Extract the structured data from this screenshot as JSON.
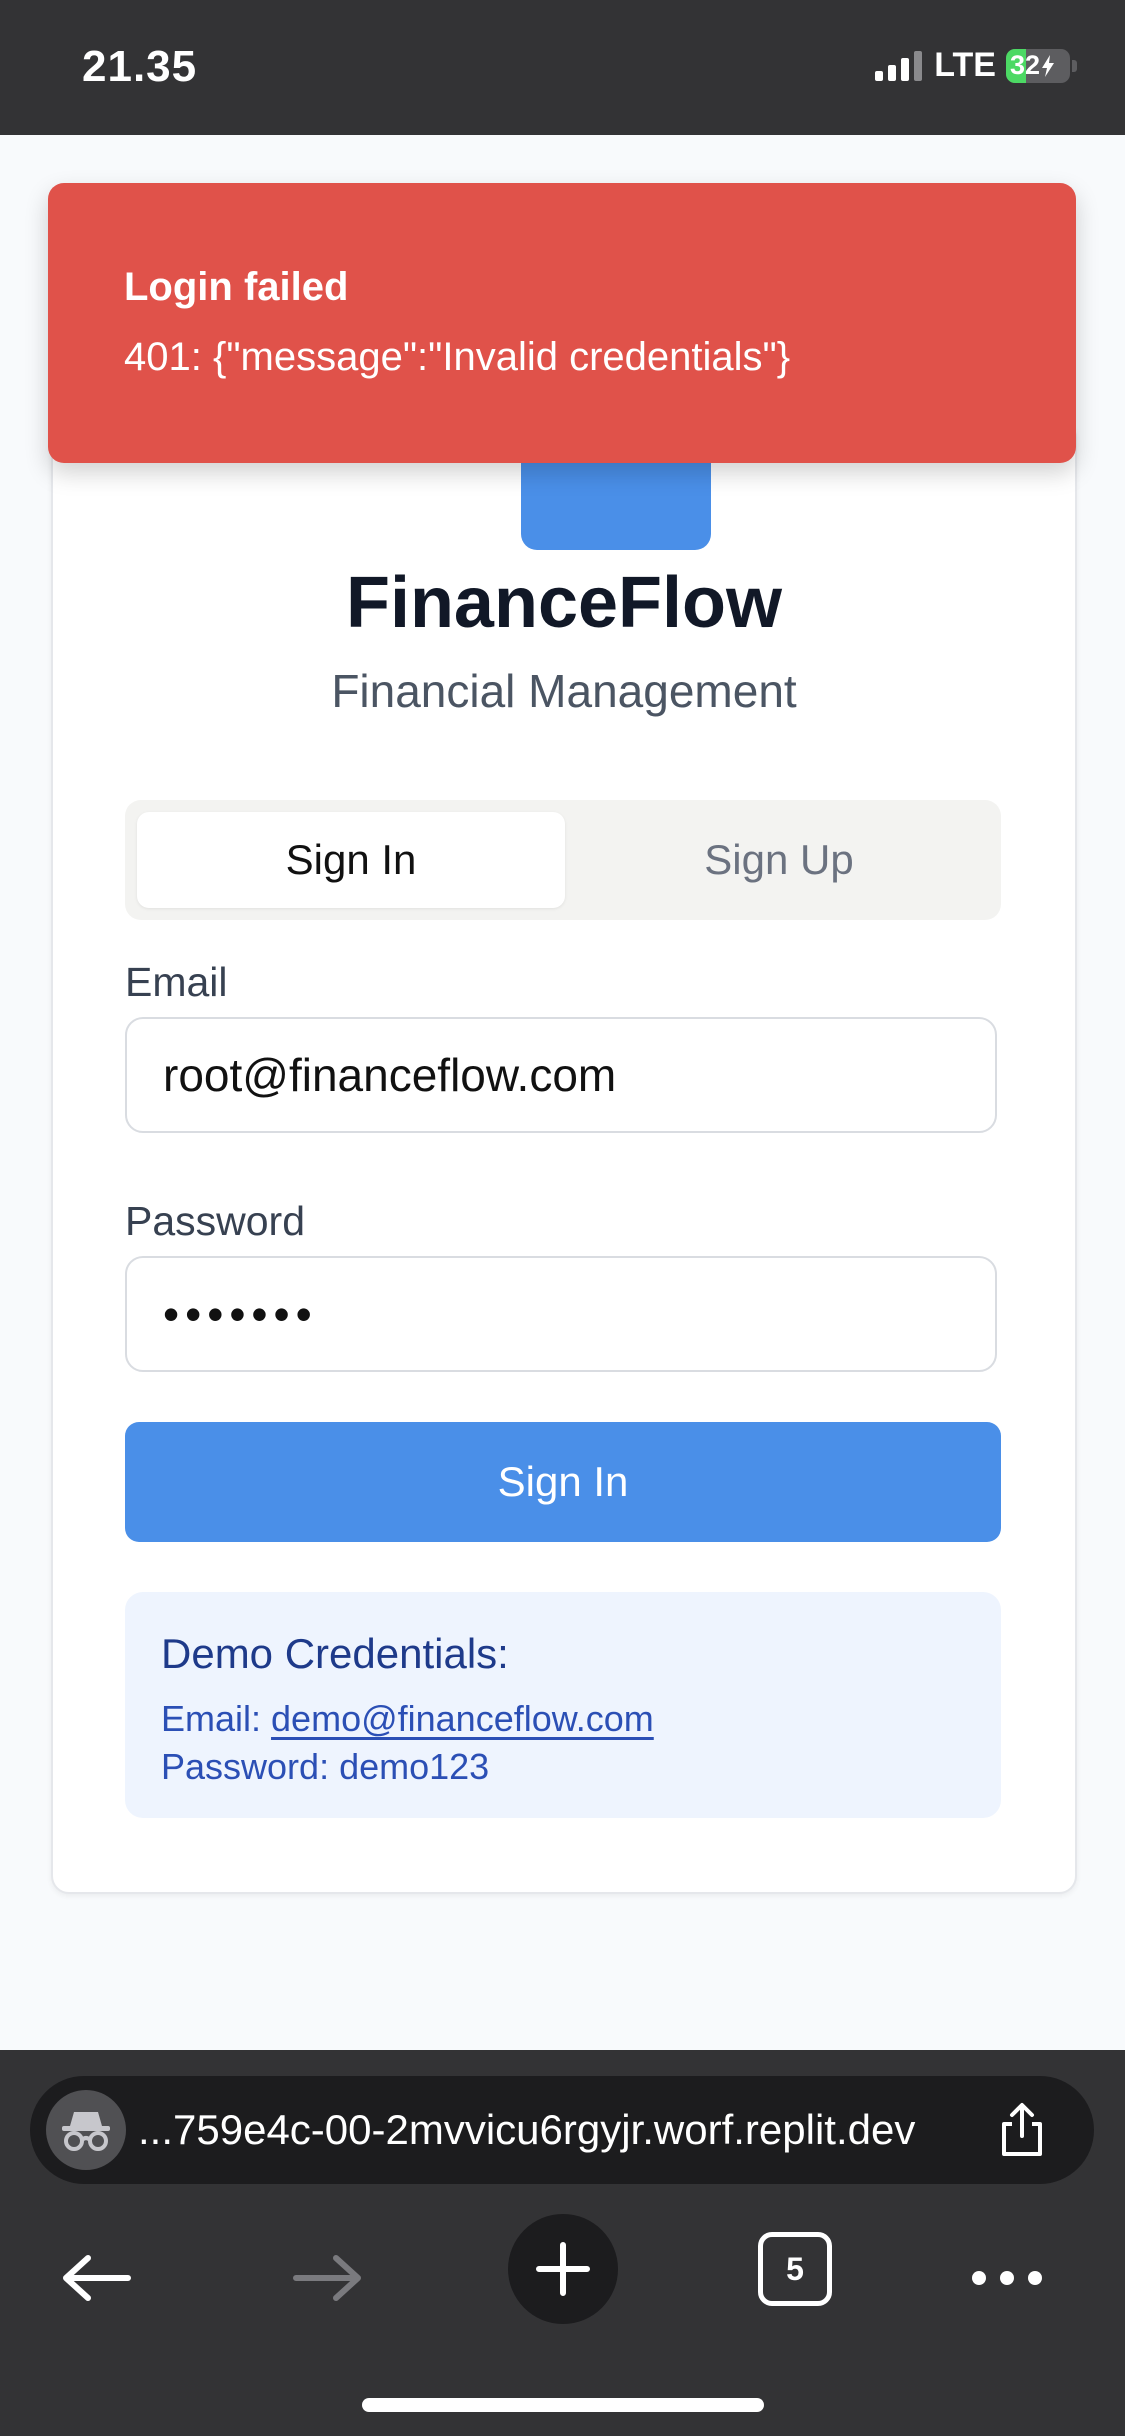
{
  "status_bar": {
    "time": "21.35",
    "network": "LTE",
    "battery_level": "32",
    "battery_percent": 32,
    "charging": true
  },
  "toast": {
    "title": "Login failed",
    "message": "401: {\"message\":\"Invalid credentials\"}",
    "color": "#e0524a"
  },
  "app": {
    "title": "FinanceFlow",
    "subtitle": "Financial Management"
  },
  "tabs": [
    {
      "label": "Sign In",
      "active": true
    },
    {
      "label": "Sign Up",
      "active": false
    }
  ],
  "form": {
    "email_label": "Email",
    "email_value": "root@financeflow.com",
    "password_label": "Password",
    "password_masked": "•••••••",
    "submit_label": "Sign In"
  },
  "demo": {
    "title": "Demo Credentials:",
    "email_prefix": "Email: ",
    "email": "demo@financeflow.com",
    "password_line": "Password: demo123"
  },
  "browser": {
    "url": "...759e4c-00-2mvvicu6rgyjr.worf.replit.dev",
    "tab_count": "5",
    "accent": "#4a8fe8"
  },
  "icons": [
    "signal-icon",
    "battery-icon",
    "private-browsing-icon",
    "share-icon",
    "back-arrow-icon",
    "forward-arrow-icon",
    "new-tab-icon",
    "tabs-icon",
    "more-icon"
  ]
}
